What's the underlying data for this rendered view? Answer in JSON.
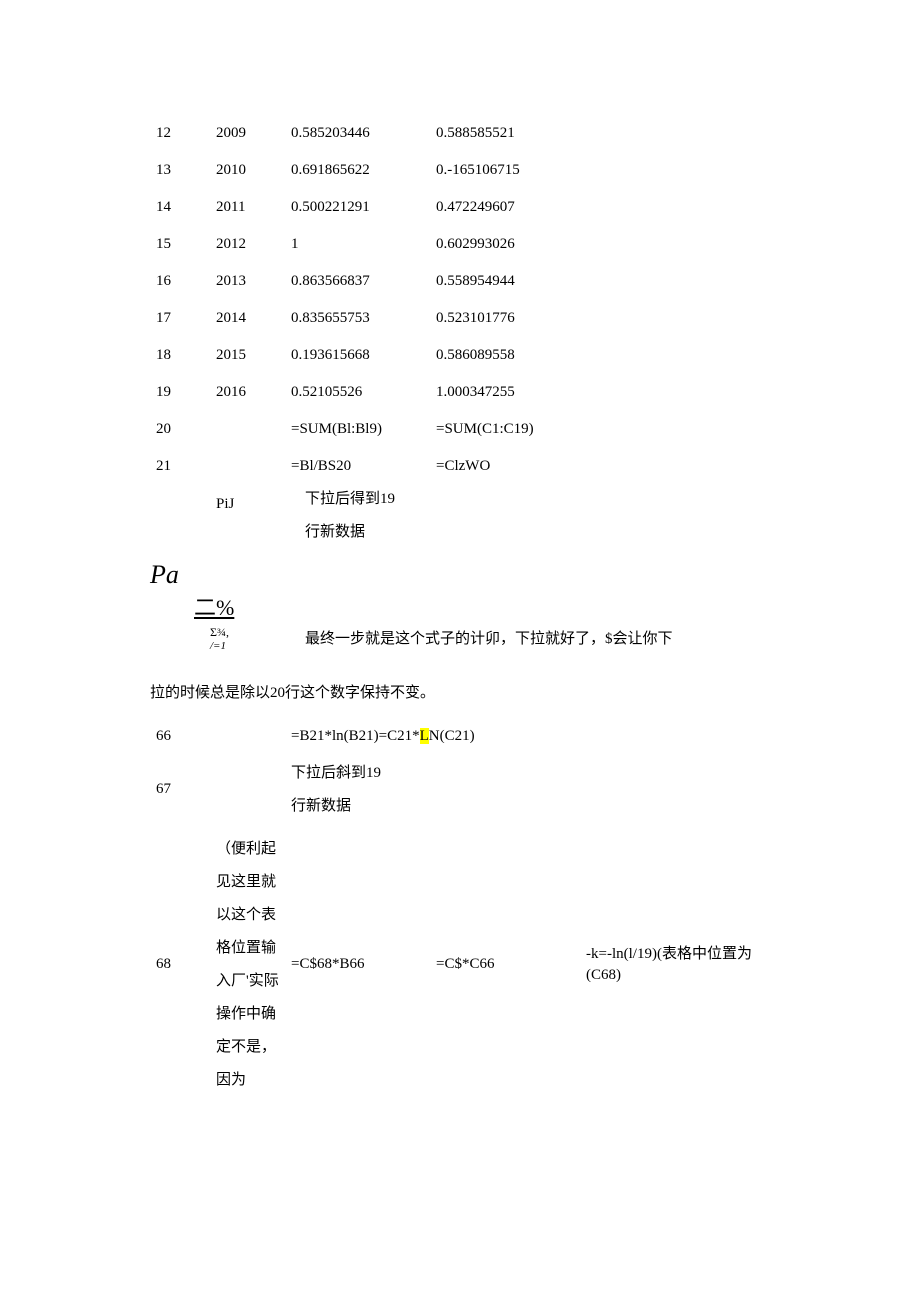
{
  "rows_top": [
    {
      "a": "12",
      "b": "2009",
      "c": "0.585203446",
      "d": "0.588585521"
    },
    {
      "a": "13",
      "b": "2010",
      "c": "0.691865622",
      "d": "0.-165106715"
    },
    {
      "a": "14",
      "b": "2011",
      "c": "0.500221291",
      "d": "0.472249607"
    },
    {
      "a": "15",
      "b": "2012",
      "c": "1",
      "d": "0.602993026"
    },
    {
      "a": "16",
      "b": "2013",
      "c": "0.863566837",
      "d": "0.558954944"
    },
    {
      "a": "17",
      "b": "2014",
      "c": "0.835655753",
      "d": "0.523101776"
    },
    {
      "a": "18",
      "b": "2015",
      "c": "0.193615668",
      "d": "0.586089558"
    },
    {
      "a": "19",
      "b": "2016",
      "c": "0.52105526",
      "d": "1.000347255"
    }
  ],
  "row20": {
    "a": "20",
    "b": "",
    "c": "=SUM(Bl:Bl9)",
    "d": "=SUM(C1:C19)"
  },
  "row21": {
    "a": "21",
    "b": "PiJ",
    "c": "=Bl/BS20",
    "d": "=ClzWO"
  },
  "row21_followC1": "下拉后得到19",
  "row21_followC2": "行新数据",
  "pa": "Pa",
  "er_pct": "二%",
  "sigma_top": "Σ¾,",
  "sigma_sub": "/=1",
  "sigma_text": "最终一步就是这个式子的计卯，下拉就好了，$会让你下",
  "para": "拉的时候总是除以20行这个数字保持不变。",
  "row66": {
    "a": "66",
    "c_pre": "=B21*ln(B21)=C21*",
    "c_hl": "L",
    "c_post": "N(C21)"
  },
  "row67": {
    "a": "67",
    "c1": "下拉后斜到19",
    "c2": "行新数据"
  },
  "row68": {
    "a": "68",
    "b": "（便利起见这里就以这个表格位置输入厂'实际操作中确定不是，因为",
    "c": "=C$68*B66",
    "d": "=C$*C66",
    "e": "-k=-ln(l/19)(表格中位置为(C68)"
  }
}
